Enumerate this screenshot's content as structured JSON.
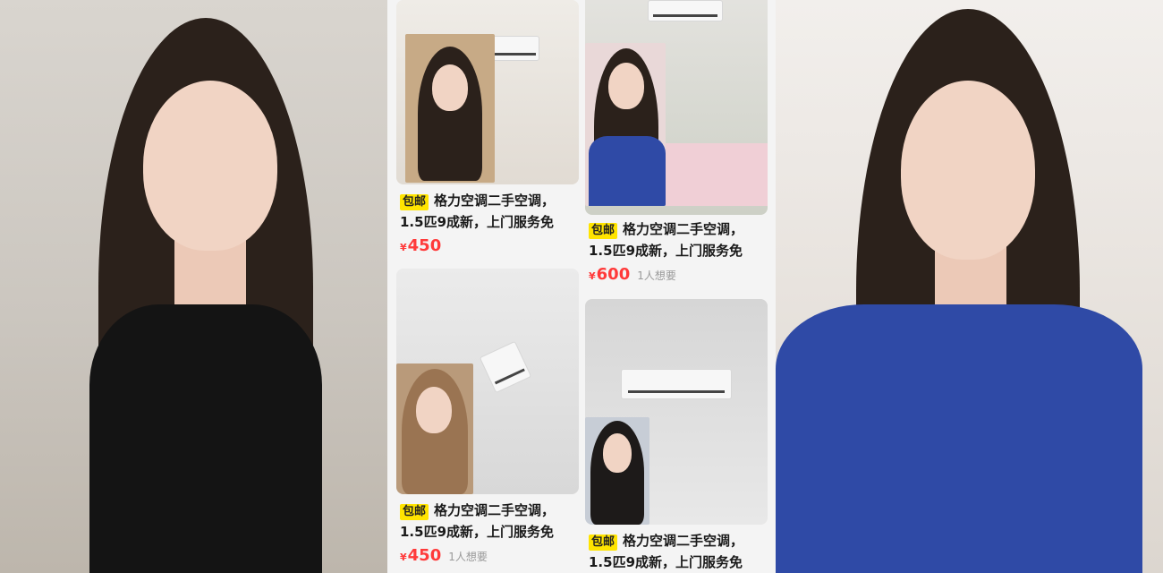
{
  "feed": {
    "items": [
      {
        "tag": "包邮",
        "title_line1": "格力空调二手空调，",
        "title_line2": "1.5匹9成新，上门服务免",
        "currency": "¥",
        "price": "450",
        "wants": ""
      },
      {
        "tag": "包邮",
        "title_line1": "格力空调二手空调，",
        "title_line2": "1.5匹9成新，上门服务免",
        "currency": "¥",
        "price": "600",
        "wants": "1人想要"
      },
      {
        "tag": "包邮",
        "title_line1": "格力空调二手空调，",
        "title_line2": "1.5匹9成新，上门服务免",
        "currency": "¥",
        "price": "450",
        "wants": "1人想要"
      },
      {
        "tag": "包邮",
        "title_line1": "格力空调二手空调，",
        "title_line2": "1.5匹9成新，上门服务免",
        "currency": "",
        "price": "",
        "wants": ""
      }
    ]
  },
  "colors": {
    "price_red": "#ff3a3a",
    "tag_yellow": "#ffe400",
    "feed_bg": "#f4f4f4"
  }
}
